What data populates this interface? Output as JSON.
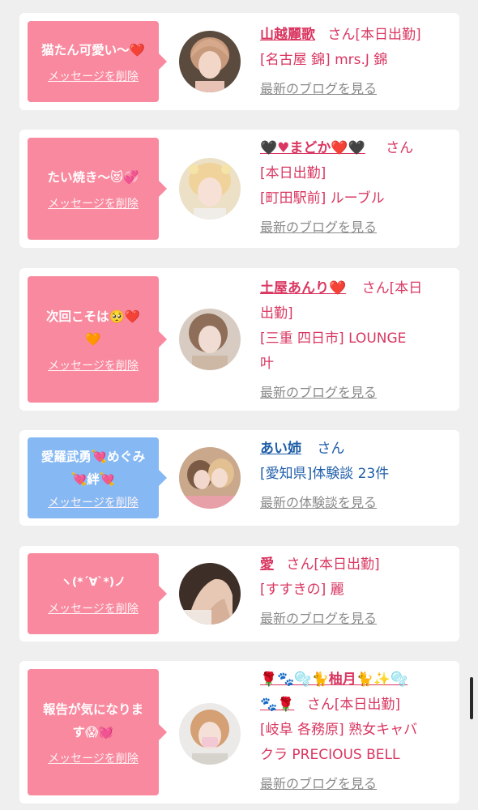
{
  "colors": {
    "bubble_pink": "#f9899f",
    "bubble_blue": "#86b9f3",
    "name_pink": "#d93660",
    "name_blue": "#1f5ea8",
    "link_gray": "#8a8a8a",
    "background": "#efefef"
  },
  "delete_label": "メッセージを削除",
  "cards": [
    {
      "bubble_lines": [
        "猫たん可愛い〜❤️"
      ],
      "name": "山越麗歌",
      "name_suffix": "さん[本日出勤]",
      "detail_lines": [
        "[名古屋 錦] mrs.J 錦"
      ],
      "link": "最新のブログを見る",
      "icon": "avatar-photo"
    },
    {
      "bubble_lines": [
        "たい焼き〜😻💞"
      ],
      "name": "🖤♥まどか❤️🖤",
      "name_suffix": "さん",
      "detail_lines": [
        "[本日出勤]",
        "[町田駅前] ルーブル"
      ],
      "link": "最新のブログを見る",
      "icon": "avatar-photo"
    },
    {
      "bubble_lines": [
        "次回こそは🥺❤️",
        "🧡"
      ],
      "name": "土屋あんり❤️",
      "name_suffix": "さん[本日",
      "detail_lines": [
        "出勤]",
        "[三重 四日市] LOUNGE",
        "叶"
      ],
      "link": "最新のブログを見る",
      "icon": "avatar-photo"
    },
    {
      "bubble_lines": [
        "愛羅武勇💘めぐみ",
        "💘絆💘"
      ],
      "name": "あい姉",
      "name_suffix": "さん",
      "detail_lines": [
        "[愛知県]体験談 23件"
      ],
      "link": "最新の体験談を見る",
      "icon": "avatar-photo"
    },
    {
      "bubble_lines": [
        "ヽ(*´∀`*)ノ"
      ],
      "name": "愛",
      "name_suffix": "さん[本日出勤]",
      "detail_lines": [
        "[すすきの] 麗"
      ],
      "link": "最新のブログを見る",
      "icon": "avatar-photo"
    },
    {
      "bubble_lines": [
        "報告が気になりま",
        "す😱💓"
      ],
      "name": "🌹🐾🫧🐈柚月🐈✨🫧",
      "name_line2": "🐾🌹",
      "name_suffix": "さん[本日出勤]",
      "detail_lines": [
        "[岐阜 各務原] 熟女キャバ",
        "クラ PRECIOUS BELL"
      ],
      "link": "最新のブログを見る",
      "icon": "avatar-photo"
    }
  ]
}
